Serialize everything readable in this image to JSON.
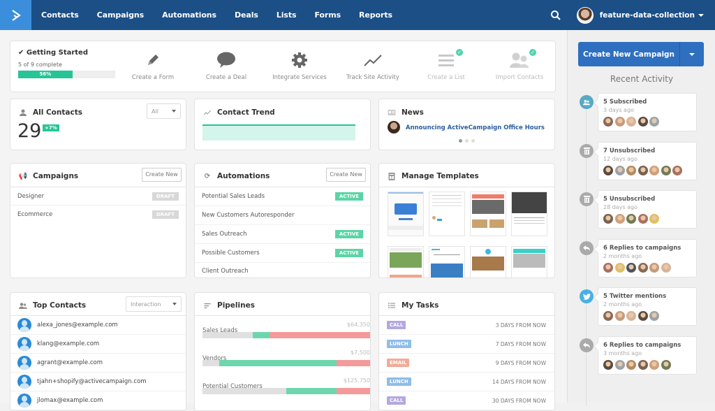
{
  "nav": {
    "logo": "ActiveCampaign",
    "items": [
      "Contacts",
      "Campaigns",
      "Automations",
      "Deals",
      "Lists",
      "Forms",
      "Reports"
    ],
    "user": "feature-data-collection"
  },
  "getting_started": {
    "title": "Getting Started",
    "subtitle": "5 of 9 complete",
    "progress_percent": 56,
    "progress_label": "56%",
    "steps": [
      {
        "label": "Create a Form",
        "icon": "pencil-icon",
        "done": false
      },
      {
        "label": "Create a Deal",
        "icon": "speech-bubble-icon",
        "done": false
      },
      {
        "label": "Integrate Services",
        "icon": "gear-icon",
        "done": false
      },
      {
        "label": "Track Site Activity",
        "icon": "line-chart-icon",
        "done": false
      },
      {
        "label": "Create a List",
        "icon": "list-icon",
        "done": true
      },
      {
        "label": "Import Contacts",
        "icon": "users-icon",
        "done": true
      }
    ]
  },
  "all_contacts": {
    "title": "All Contacts",
    "count": "29",
    "change": "+7%",
    "filter": "All"
  },
  "contact_trend": {
    "title": "Contact Trend"
  },
  "news": {
    "title": "News",
    "headline": "Announcing ActiveCampaign Office Hours",
    "pages": 3,
    "active_page": 1
  },
  "campaigns": {
    "title": "Campaigns",
    "create": "Create New",
    "rows": [
      {
        "name": "Designer",
        "status": "DRAFT"
      },
      {
        "name": "Ecommerce",
        "status": "DRAFT"
      }
    ]
  },
  "automations": {
    "title": "Automations",
    "create": "Create New",
    "rows": [
      {
        "name": "Potential Sales Leads",
        "status": "ACTIVE"
      },
      {
        "name": "New Customers Autoresponder",
        "status": ""
      },
      {
        "name": "Sales Outreach",
        "status": "ACTIVE"
      },
      {
        "name": "Possible Customers",
        "status": "ACTIVE"
      },
      {
        "name": "Client Outreach",
        "status": ""
      }
    ]
  },
  "templates": {
    "title": "Manage Templates",
    "count": 8
  },
  "top_contacts": {
    "title": "Top Contacts",
    "filter": "Interaction",
    "rows": [
      "alexa_jones@example.com",
      "klang@example.com",
      "agrant@example.com",
      "tjahn+shopify@activecampaign.com",
      "jlomax@example.com"
    ]
  },
  "pipelines": {
    "title": "Pipelines",
    "rows": [
      {
        "name": "Sales Leads",
        "amount": "$64,350",
        "gray": 0.3,
        "green": 0.1,
        "red": 0.6
      },
      {
        "name": "Vendors",
        "amount": "$7,500",
        "gray": 0.1,
        "green": 0.7,
        "red": 0.2
      },
      {
        "name": "Potential Customers",
        "amount": "$125,750",
        "gray": 0.5,
        "green": 0.3,
        "red": 0.2
      }
    ]
  },
  "tasks": {
    "title": "My Tasks",
    "rows": [
      {
        "type": "CALL",
        "due": "3 DAYS FROM NOW",
        "color": "#b5a8e0"
      },
      {
        "type": "LUNCH",
        "due": "7 DAYS FROM NOW",
        "color": "#8fbde8"
      },
      {
        "type": "EMAIL",
        "due": "9 DAYS FROM NOW",
        "color": "#f2ab98"
      },
      {
        "type": "LUNCH",
        "due": "14 DAYS FROM NOW",
        "color": "#8fbde8"
      },
      {
        "type": "CALL",
        "due": "30 DAYS FROM NOW",
        "color": "#b5a8e0"
      }
    ]
  },
  "sidebar": {
    "cta": "Create New Campaign",
    "recent_title": "Recent Activity",
    "activities": [
      {
        "title": "5 Subscribed",
        "when": "3 days ago",
        "icon": "users-icon",
        "color": "#5aa9c2",
        "faces": 5
      },
      {
        "title": "7 Unsubscribed",
        "when": "12 days ago",
        "icon": "trash-icon",
        "color": "#aaaaaa",
        "faces": 7
      },
      {
        "title": "5 Unsubscribed",
        "when": "28 days ago",
        "icon": "trash-icon",
        "color": "#aaaaaa",
        "faces": 5
      },
      {
        "title": "6 Replies to campaigns",
        "when": "2 months ago",
        "icon": "reply-icon",
        "color": "#aaaaaa",
        "faces": 6
      },
      {
        "title": "5 Twitter mentions",
        "when": "2 months ago",
        "icon": "twitter-icon",
        "color": "#4ab0e3",
        "faces": 5
      },
      {
        "title": "6 Replies to campaigns",
        "when": "3 months ago",
        "icon": "reply-icon",
        "color": "#aaaaaa",
        "faces": 6
      }
    ]
  }
}
